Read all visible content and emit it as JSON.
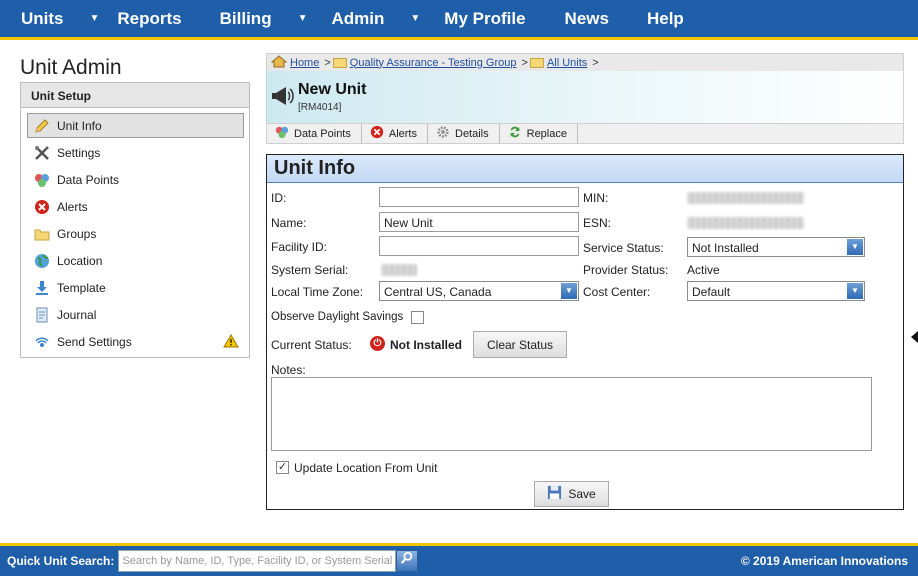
{
  "nav": {
    "items": [
      {
        "label": "Units",
        "has_menu": true
      },
      {
        "label": "Reports",
        "has_menu": false
      },
      {
        "label": "Billing",
        "has_menu": true
      },
      {
        "label": "Admin",
        "has_menu": true
      },
      {
        "label": "My Profile",
        "has_menu": false
      },
      {
        "label": "News",
        "has_menu": false
      },
      {
        "label": "Help",
        "has_menu": false
      }
    ],
    "caret": "▼"
  },
  "sidebar": {
    "page_title": "Unit Admin",
    "section_title": "Unit Setup",
    "items": [
      {
        "label": "Unit Info",
        "icon": "pencil-icon"
      },
      {
        "label": "Settings",
        "icon": "tools-icon"
      },
      {
        "label": "Data Points",
        "icon": "data-points-icon"
      },
      {
        "label": "Alerts",
        "icon": "alert-x-icon"
      },
      {
        "label": "Groups",
        "icon": "folder-icon"
      },
      {
        "label": "Location",
        "icon": "globe-icon"
      },
      {
        "label": "Template",
        "icon": "download-arrow-icon"
      },
      {
        "label": "Journal",
        "icon": "journal-icon"
      },
      {
        "label": "Send Settings",
        "icon": "signal-icon"
      }
    ]
  },
  "breadcrumb": {
    "items": [
      "Home",
      "Quality Assurance - Testing Group",
      "All Units"
    ],
    "sep": ">"
  },
  "unit": {
    "name": "New Unit",
    "code": "[RM4014]"
  },
  "tabs": [
    {
      "label": "Data Points",
      "icon": "data-points-icon"
    },
    {
      "label": "Alerts",
      "icon": "alert-x-icon"
    },
    {
      "label": "Details",
      "icon": "gear-icon"
    },
    {
      "label": "Replace",
      "icon": "replace-icon"
    }
  ],
  "form": {
    "title": "Unit Info",
    "id_label": "ID:",
    "id_value": "",
    "name_label": "Name:",
    "name_value": "New Unit",
    "facility_label": "Facility ID:",
    "facility_value": "",
    "serial_label": "System Serial:",
    "tz_label": "Local Time Zone:",
    "tz_value": "Central US, Canada",
    "dst_label": "Observe Daylight Savings",
    "status_label": "Current Status:",
    "status_value": "Not Installed",
    "clear_status": "Clear Status",
    "min_label": "MIN:",
    "esn_label": "ESN:",
    "service_label": "Service Status:",
    "service_value": "Not Installed",
    "provider_label": "Provider Status:",
    "provider_value": "Active",
    "cost_label": "Cost Center:",
    "cost_value": "Default",
    "notes_label": "Notes:",
    "update_location": "Update Location From Unit",
    "update_location_checked": true,
    "save": "Save"
  },
  "footer": {
    "search_label": "Quick Unit Search:",
    "search_placeholder": "Search by Name, ID, Type, Facility ID, or System Serial",
    "copyright": "© 2019 American Innovations"
  },
  "colors": {
    "brand_blue": "#1f5ea8",
    "accent_yellow": "#f2c500",
    "status_red": "#d0231b"
  }
}
